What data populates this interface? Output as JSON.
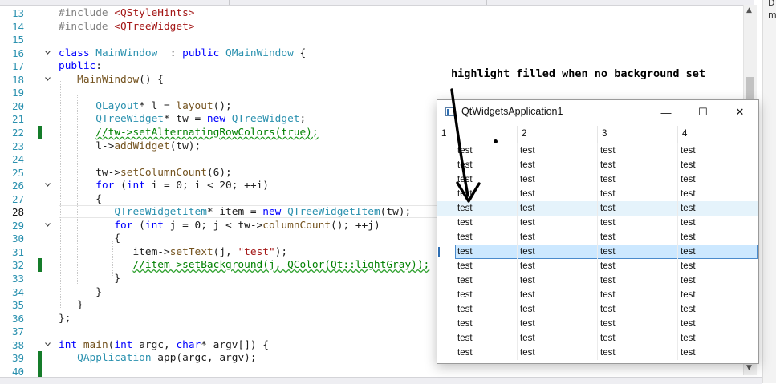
{
  "editor": {
    "lines": [
      {
        "n": "13",
        "seg": [
          [
            "pp",
            "#include "
          ],
          [
            "inc",
            "<QStyleHints>"
          ]
        ]
      },
      {
        "n": "14",
        "seg": [
          [
            "pp",
            "#include "
          ],
          [
            "inc",
            "<QTreeWidget>"
          ]
        ]
      },
      {
        "n": "15",
        "seg": []
      },
      {
        "n": "16",
        "fold": true,
        "seg": [
          [
            "kw",
            "class "
          ],
          [
            "ty",
            "MainWindow"
          ],
          [
            "",
            "  : "
          ],
          [
            "kw",
            "public "
          ],
          [
            "ty",
            "QMainWindow"
          ],
          [
            "",
            " {"
          ]
        ]
      },
      {
        "n": "17",
        "seg": [
          [
            "kw",
            "public"
          ],
          [
            "",
            ":"
          ]
        ]
      },
      {
        "n": "18",
        "fold": true,
        "seg": [
          [
            "",
            "   "
          ],
          [
            "fn",
            "MainWindow"
          ],
          [
            "",
            "() {"
          ]
        ]
      },
      {
        "n": "19",
        "seg": []
      },
      {
        "n": "20",
        "seg": [
          [
            "",
            "      "
          ],
          [
            "ty",
            "QLayout"
          ],
          [
            "",
            "* l = "
          ],
          [
            "fn",
            "layout"
          ],
          [
            "",
            "();"
          ]
        ]
      },
      {
        "n": "21",
        "seg": [
          [
            "",
            "      "
          ],
          [
            "ty",
            "QTreeWidget"
          ],
          [
            "",
            "* tw = "
          ],
          [
            "kw",
            "new "
          ],
          [
            "ty",
            "QTreeWidget"
          ],
          [
            "",
            ";"
          ]
        ]
      },
      {
        "n": "22",
        "mark": true,
        "seg": [
          [
            "",
            "      "
          ],
          [
            "cm",
            "//tw->setAlternatingRowColors(true);"
          ]
        ]
      },
      {
        "n": "23",
        "seg": [
          [
            "",
            "      l->"
          ],
          [
            "fn",
            "addWidget"
          ],
          [
            "",
            "(tw);"
          ]
        ]
      },
      {
        "n": "24",
        "seg": []
      },
      {
        "n": "25",
        "seg": [
          [
            "",
            "      tw->"
          ],
          [
            "fn",
            "setColumnCount"
          ],
          [
            "",
            "(6);"
          ]
        ]
      },
      {
        "n": "26",
        "fold": true,
        "seg": [
          [
            "",
            "      "
          ],
          [
            "kw",
            "for "
          ],
          [
            "",
            "("
          ],
          [
            "kw",
            "int "
          ],
          [
            "",
            "i = 0; i < 20; ++i)"
          ]
        ]
      },
      {
        "n": "27",
        "seg": [
          [
            "",
            "      {"
          ]
        ]
      },
      {
        "n": "28",
        "current": true,
        "seg": [
          [
            "",
            "         "
          ],
          [
            "ty",
            "QTreeWidgetItem"
          ],
          [
            "",
            "* item = "
          ],
          [
            "kw",
            "new "
          ],
          [
            "ty",
            "QTreeWidgetItem"
          ],
          [
            "",
            "(tw);"
          ]
        ]
      },
      {
        "n": "29",
        "fold": true,
        "seg": [
          [
            "",
            "         "
          ],
          [
            "kw",
            "for "
          ],
          [
            "",
            "("
          ],
          [
            "kw",
            "int "
          ],
          [
            "",
            "j = 0; j < tw->"
          ],
          [
            "fn",
            "columnCount"
          ],
          [
            "",
            "(); ++j)"
          ]
        ]
      },
      {
        "n": "30",
        "seg": [
          [
            "",
            "         {"
          ]
        ]
      },
      {
        "n": "31",
        "seg": [
          [
            "",
            "            item->"
          ],
          [
            "fn",
            "setText"
          ],
          [
            "",
            "(j, "
          ],
          [
            "str",
            "\"test\""
          ],
          [
            "",
            ");"
          ]
        ]
      },
      {
        "n": "32",
        "mark": true,
        "seg": [
          [
            "",
            "            "
          ],
          [
            "cm",
            "//item->setBackground(j, QColor(Qt::lightGray));"
          ]
        ]
      },
      {
        "n": "33",
        "seg": [
          [
            "",
            "         }"
          ]
        ]
      },
      {
        "n": "34",
        "seg": [
          [
            "",
            "      }"
          ]
        ]
      },
      {
        "n": "35",
        "seg": [
          [
            "",
            "   }"
          ]
        ]
      },
      {
        "n": "36",
        "seg": [
          [
            "",
            "};"
          ]
        ]
      },
      {
        "n": "37",
        "seg": []
      },
      {
        "n": "38",
        "fold": true,
        "seg": [
          [
            "kw",
            "int "
          ],
          [
            "fn",
            "main"
          ],
          [
            "",
            "("
          ],
          [
            "kw",
            "int "
          ],
          [
            "",
            "argc, "
          ],
          [
            "kw",
            "char"
          ],
          [
            "",
            "* argv[]) {"
          ]
        ]
      },
      {
        "n": "39",
        "mark": true,
        "seg": [
          [
            "",
            "   "
          ],
          [
            "ty",
            "QApplication"
          ],
          [
            "",
            " app(argc, argv);"
          ]
        ]
      },
      {
        "n": "40",
        "mark": true,
        "seg": []
      }
    ]
  },
  "annotation": "highlight filled when no background set",
  "qt_window": {
    "title": "QtWidgetsApplication1",
    "minimize": "—",
    "maximize": "☐",
    "close": "✕",
    "headers": [
      "1",
      "2",
      "3",
      "4"
    ],
    "cell_text": "test",
    "row_count": 15,
    "hover_row": 4,
    "selected_row": 7
  },
  "right_panel": [
    "D",
    "m"
  ]
}
